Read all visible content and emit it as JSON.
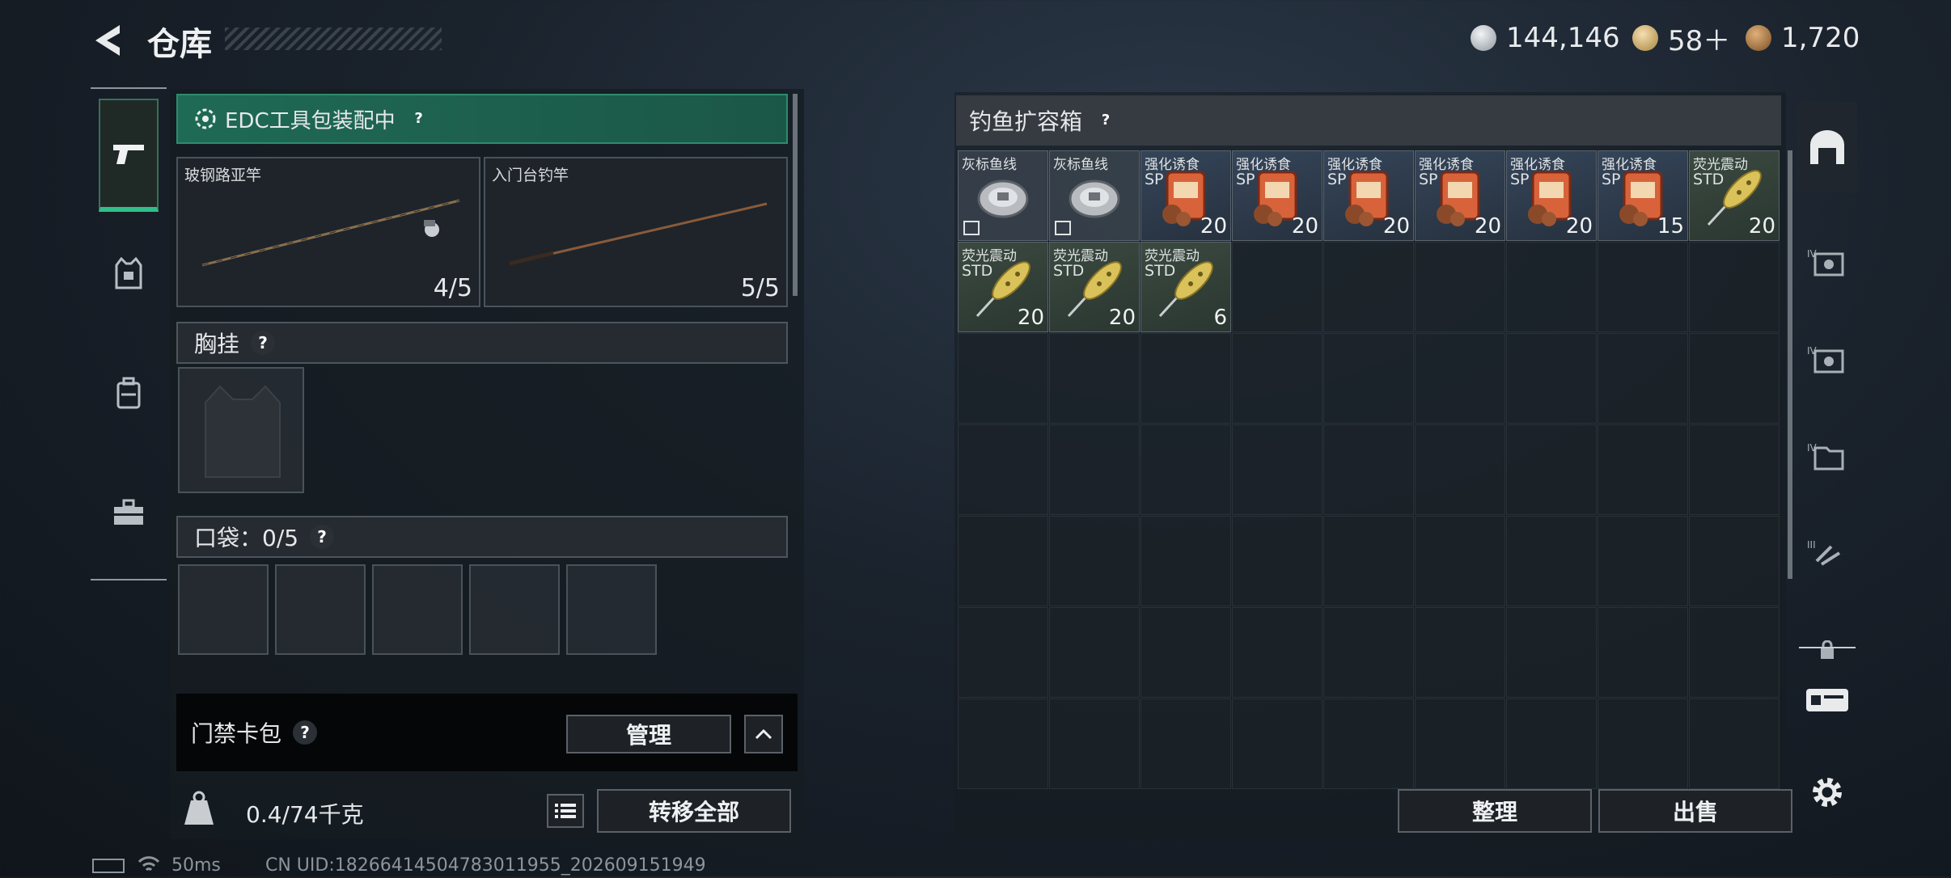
{
  "header": {
    "title": "仓库"
  },
  "currencies": [
    {
      "icon": "silver-coin-icon",
      "value": "144,146",
      "color": "#c9cdd1"
    },
    {
      "icon": "gold-triangle-icon",
      "value": "58＋",
      "color": "#d9b56a"
    },
    {
      "icon": "bronze-coin-icon",
      "value": "1,720",
      "color": "#b6824a"
    }
  ],
  "left": {
    "edc_label": "EDC工具包装配中",
    "weapon_slots": [
      {
        "name": "玻钢路亚竿",
        "count": "4/5"
      },
      {
        "name": "入门台钓竿",
        "count": "5/5"
      }
    ],
    "chest_label": "胸挂",
    "pocket_label": "口袋：0/5",
    "card_label": "门禁卡包",
    "manage_btn": "管理",
    "weight": "0.4/74千克",
    "transfer_btn": "转移全部"
  },
  "right": {
    "container_title": "钓鱼扩容箱",
    "sort_btn": "整理",
    "sell_btn": "出售",
    "items": [
      {
        "name": "灰标鱼线",
        "tag": "",
        "count": "",
        "kind": "line"
      },
      {
        "name": "灰标鱼线",
        "tag": "",
        "count": "",
        "kind": "line"
      },
      {
        "name": "强化诱食",
        "tag": "SP",
        "count": "20",
        "kind": "bait"
      },
      {
        "name": "强化诱食",
        "tag": "SP",
        "count": "20",
        "kind": "bait"
      },
      {
        "name": "强化诱食",
        "tag": "SP",
        "count": "20",
        "kind": "bait"
      },
      {
        "name": "强化诱食",
        "tag": "SP",
        "count": "20",
        "kind": "bait"
      },
      {
        "name": "强化诱食",
        "tag": "SP",
        "count": "20",
        "kind": "bait"
      },
      {
        "name": "强化诱食",
        "tag": "SP",
        "count": "15",
        "kind": "bait"
      },
      {
        "name": "荧光震动",
        "tag": "STD",
        "count": "20",
        "kind": "lure"
      },
      {
        "name": "荧光震动",
        "tag": "STD",
        "count": "20",
        "kind": "lure"
      },
      {
        "name": "荧光震动",
        "tag": "STD",
        "count": "20",
        "kind": "lure"
      },
      {
        "name": "荧光震动",
        "tag": "STD",
        "count": "6",
        "kind": "lure"
      }
    ]
  },
  "status": {
    "ping": "50ms",
    "uid": "CN UID:1826641450478301​1955_202609151949"
  }
}
